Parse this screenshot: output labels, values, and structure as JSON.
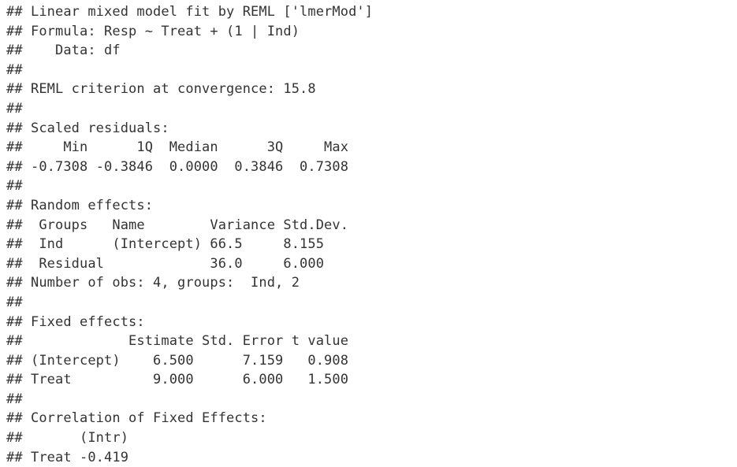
{
  "output": {
    "lines": [
      "## Linear mixed model fit by REML ['lmerMod']",
      "## Formula: Resp ~ Treat + (1 | Ind)",
      "##    Data: df",
      "##",
      "## REML criterion at convergence: 15.8",
      "##",
      "## Scaled residuals:",
      "##     Min      1Q  Median      3Q     Max",
      "## -0.7308 -0.3846  0.0000  0.3846  0.7308",
      "##",
      "## Random effects:",
      "##  Groups   Name        Variance Std.Dev.",
      "##  Ind      (Intercept) 66.5     8.155",
      "##  Residual             36.0     6.000",
      "## Number of obs: 4, groups:  Ind, 2",
      "##",
      "## Fixed effects:",
      "##             Estimate Std. Error t value",
      "## (Intercept)    6.500      7.159   0.908",
      "## Treat          9.000      6.000   1.500",
      "##",
      "## Correlation of Fixed Effects:",
      "##       (Intr)",
      "## Treat -0.419"
    ]
  }
}
